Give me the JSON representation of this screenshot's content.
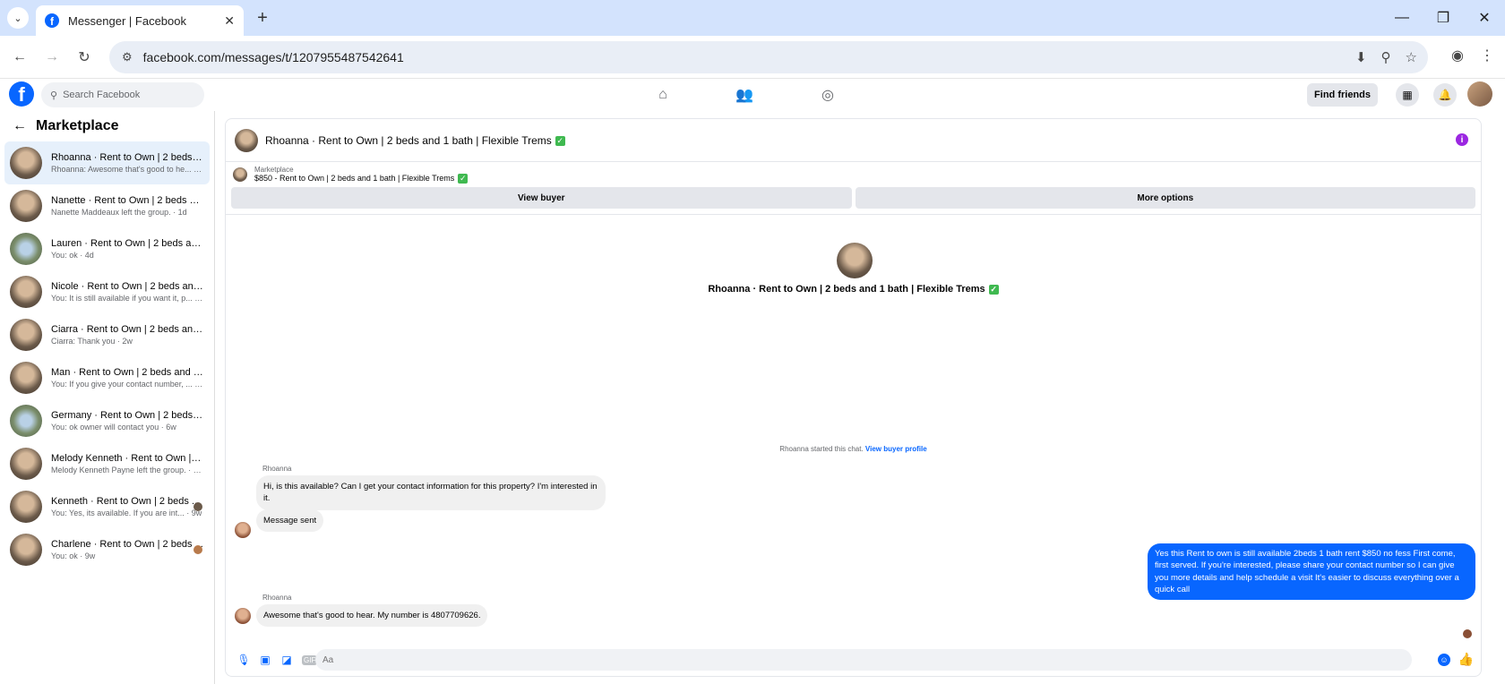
{
  "browser": {
    "tab_title": "Messenger | Facebook",
    "url": "facebook.com/messages/t/1207955487542641"
  },
  "fb": {
    "search_placeholder": "Search Facebook",
    "find_friends": "Find friends"
  },
  "sidebar": {
    "title": "Marketplace",
    "conversations": [
      {
        "name": "Rhoanna · Rent to Own | 2 beds an...",
        "preview": "Rhoanna: Awesome that's good to he... · 1m"
      },
      {
        "name": "Nanette · Rent to Own | 2 beds an...",
        "preview": "Nanette Maddeaux left the group. · 1d"
      },
      {
        "name": "Lauren · Rent to Own | 2 beds and ...",
        "preview": "You: ok · 4d"
      },
      {
        "name": "Nicole · Rent to Own | 2 beds and ...",
        "preview": "You: It is still available if you want it, p... · 2w"
      },
      {
        "name": "Ciarra · Rent to Own | 2 beds and 1...",
        "preview": "Ciarra: Thank you · 2w"
      },
      {
        "name": "Man · Rent to Own | 2 beds and 1 ...",
        "preview": "You: If you give your contact number, ... · 5w"
      },
      {
        "name": "Germany · Rent to Own | 2 beds a...",
        "preview": "You: ok owner will contact you · 6w"
      },
      {
        "name": "Melody Kenneth · Rent to Own | 2 ...",
        "preview": "Melody Kenneth Payne left the group. · 9w"
      },
      {
        "name": "Kenneth · Rent to Own | 2 beds ...",
        "preview": "You: Yes, its available. If you are int... · 9w"
      },
      {
        "name": "Charlene · Rent to Own | 2 beds ...",
        "preview": "You: ok · 9w"
      }
    ]
  },
  "chat": {
    "header_name": "Rhoanna · Rent to Own | 2 beds and 1 bath | Flexible Trems",
    "checkmark": "✓",
    "marketplace_label": "Marketplace",
    "listing": "$850 - Rent to Own | 2 beds and 1 bath | Flexible Trems",
    "view_buyer": "View buyer",
    "more_options": "More options",
    "center_name": "Rhoanna · Rent to Own | 2 beds and 1 bath | Flexible Trems",
    "started_text": "Rhoanna started this chat.",
    "view_buyer_profile": "View buyer profile",
    "sender1": "Rhoanna",
    "msg1": "Hi, is this available? Can I get your contact information for this property? I'm interested in it.",
    "msg2": "Message sent",
    "msg_out": "Yes this Rent to own is still available 2beds 1 bath rent $850 no fess First come, first served. If you're interested, please share your contact number so I can give you more details and help schedule a visit It's easier to discuss everything over a quick call",
    "sender2": "Rhoanna",
    "msg3": "Awesome that's good to hear. My number is 4807709626.",
    "composer_placeholder": "Aa",
    "gif_label": "GIF"
  },
  "colors": {
    "accent": "#0866ff",
    "tab_bg": "#d3e3fd",
    "check": "#3fb950",
    "info": "#9b27e1"
  }
}
